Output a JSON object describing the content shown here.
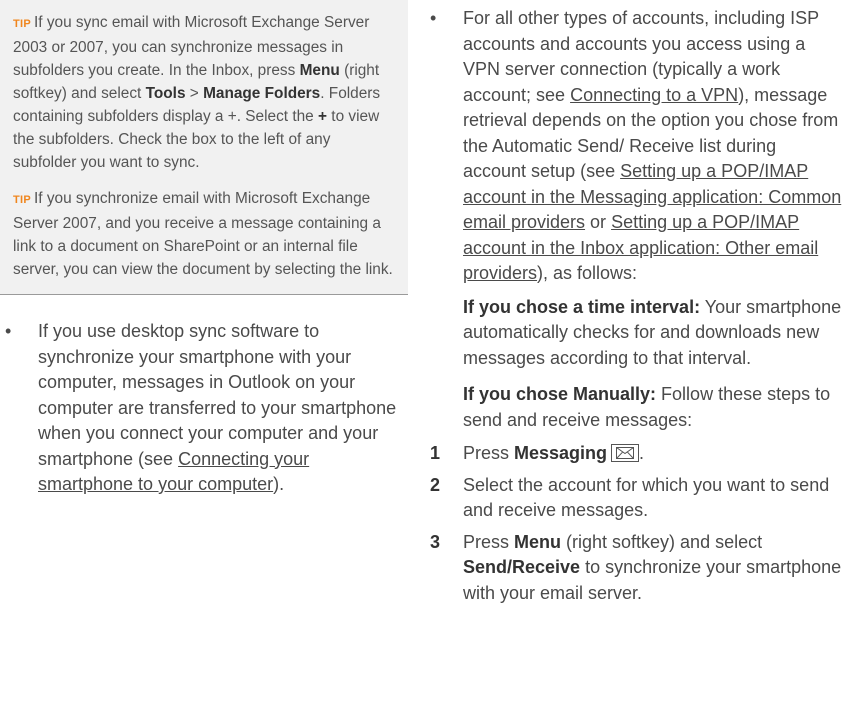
{
  "tips": [
    {
      "label": "TIP",
      "parts": [
        "If you sync email with Microsoft Exchange Server 2003 or 2007, you can synchronize messages in subfolders you create. In the Inbox, press ",
        "Menu",
        " (right softkey) and select ",
        "Tools",
        " > ",
        "Manage Folders",
        ". Folders containing subfolders display a +. Select the ",
        "+",
        " to view the subfolders. Check the box to the left of any subfolder you want to sync."
      ]
    },
    {
      "label": "TIP",
      "text": "If you synchronize email with Microsoft Exchange Server 2007, and you receive a message containing a link to a document on SharePoint or an internal file server, you can view the document by selecting the link."
    }
  ],
  "left_bullet": {
    "dot": "•",
    "text": "If you use desktop sync software to synchronize your smartphone with your computer, messages in Outlook on your computer are transferred to your smartphone when you connect your computer and your smartphone (see ",
    "link": "Connecting your smartphone to your computer",
    "after": ")."
  },
  "right_bullet": {
    "dot": "•",
    "t1": "For all other types of accounts, including ISP accounts and accounts you access using a VPN server connection (typically a work account; see ",
    "link1": "Connecting to a VPN",
    "t2": "), message retrieval depends on the option you chose from the Automatic Send/ Receive list during account setup (see ",
    "link2": "Setting up a POP/IMAP account in the Messaging application: Common email providers",
    "t3": " or ",
    "link3": "Setting up a POP/IMAP account in the Inbox application: Other email providers",
    "t4": "), as follows:"
  },
  "interval_para": {
    "bold": "If you chose a time interval:",
    "text": " Your smartphone automatically checks for and downloads new messages according to that interval."
  },
  "manual_para": {
    "bold": "If you chose Manually:",
    "text": " Follow these steps to send and receive messages:"
  },
  "steps": [
    {
      "num": "1",
      "pre": "Press ",
      "bold": "Messaging",
      "icon": "envelope-key-icon"
    },
    {
      "num": "2",
      "text": "Select the account for which you want to send and receive messages."
    },
    {
      "num": "3",
      "pre": "Press ",
      "bold1": "Menu",
      "mid": " (right softkey) and select ",
      "bold2": "Send/Receive",
      "post": " to synchronize your smartphone with your email server."
    }
  ],
  "colors": {
    "tip_label": "#f0861e",
    "tip_background": "#f1f1f1",
    "text": "#4a4a4a"
  }
}
